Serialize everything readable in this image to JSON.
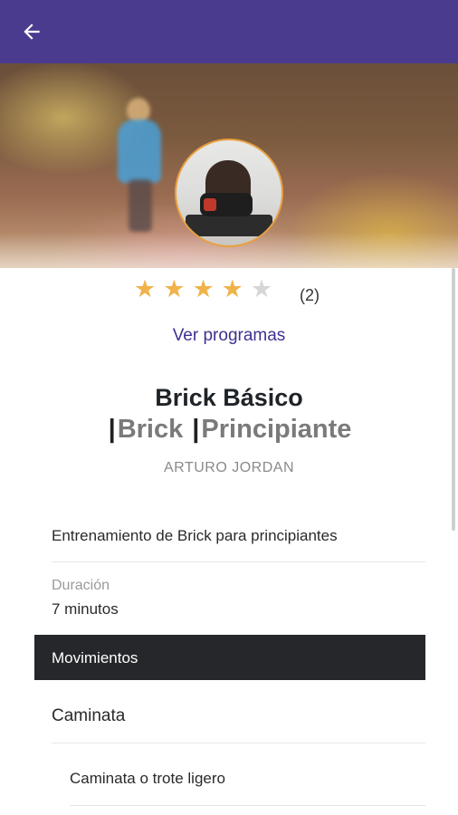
{
  "header": {
    "back_icon": "arrow-left-icon",
    "bg_color": "#4a3b8f"
  },
  "rating": {
    "value": 4,
    "max": 5,
    "count_label": "(2)",
    "star_color": "#f0b34a"
  },
  "programs_link": "Ver programas",
  "workout": {
    "title": "Brick Básico",
    "tags": [
      "Brick",
      "Principiante"
    ],
    "author": "ARTURO JORDAN",
    "description": "Entrenamiento de Brick para principiantes",
    "duration_label": "Duración",
    "duration_value": "7 minutos"
  },
  "movements": {
    "section_label": "Movimientos",
    "items": [
      {
        "name": "Caminata",
        "sub": "Caminata o trote ligero"
      }
    ]
  }
}
